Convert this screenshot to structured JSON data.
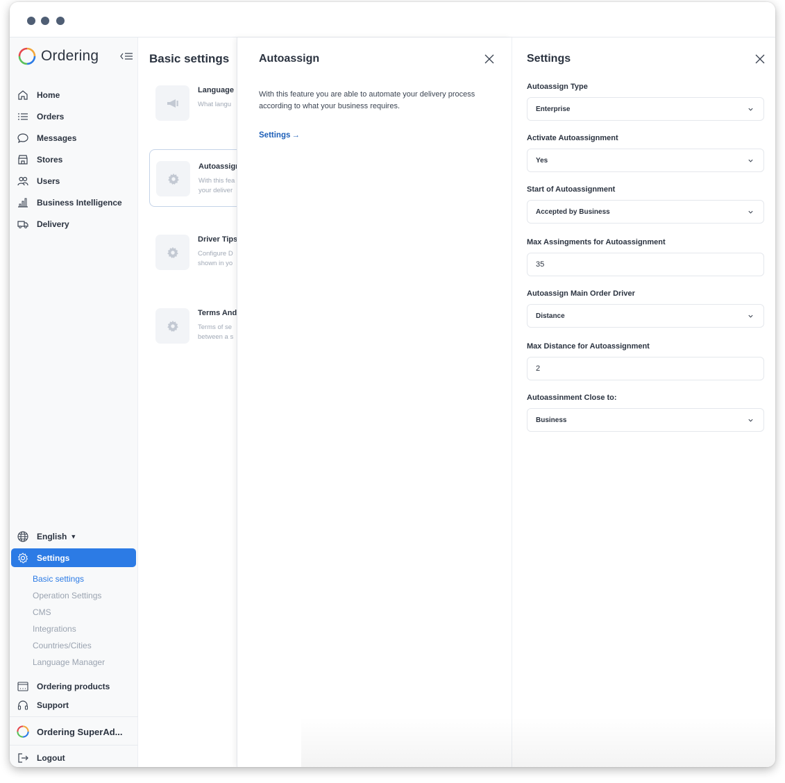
{
  "app": {
    "brand": "Ordering"
  },
  "sidebar": {
    "items": [
      {
        "label": "Home",
        "icon": "home-icon"
      },
      {
        "label": "Orders",
        "icon": "list-icon"
      },
      {
        "label": "Messages",
        "icon": "chat-icon"
      },
      {
        "label": "Stores",
        "icon": "store-icon"
      },
      {
        "label": "Users",
        "icon": "users-icon"
      },
      {
        "label": "Business Intelligence",
        "icon": "bar-chart-icon"
      },
      {
        "label": "Delivery",
        "icon": "truck-icon"
      }
    ],
    "language": "English",
    "settings_label": "Settings",
    "sub_items": [
      "Basic settings",
      "Operation Settings",
      "CMS",
      "Integrations",
      "Countries/Cities",
      "Language Manager"
    ],
    "ordering_products": "Ordering products",
    "support": "Support",
    "account_name": "Ordering SuperAd...",
    "logout": "Logout",
    "accent_color": "#2c7be5"
  },
  "basic_settings": {
    "title": "Basic settings",
    "cards": [
      {
        "title": "Language",
        "desc": "What langu",
        "icon": "megaphone-icon"
      },
      {
        "title": "Autoassign",
        "desc": "With this fea\nyour deliver",
        "icon": "gear-icon"
      },
      {
        "title": "Driver Tips",
        "desc": "Configure D\nshown in yo",
        "icon": "gear-icon"
      },
      {
        "title": "Terms And",
        "desc": "Terms of se\nbetween a s",
        "icon": "gear-icon"
      }
    ]
  },
  "autoassign": {
    "title": "Autoassign",
    "description": "With this feature you are able to automate your delivery process according to what your business requires.",
    "link_label": "Settings"
  },
  "settings_panel": {
    "title": "Settings",
    "fields": [
      {
        "label": "Autoassign Type",
        "value": "Enterprise",
        "kind": "select"
      },
      {
        "label": "Activate Autoassignment",
        "value": "Yes",
        "kind": "select"
      },
      {
        "label": "Start of Autoassignment",
        "value": "Accepted by Business",
        "kind": "select"
      },
      {
        "label": "Max Assingments for Autoassignment",
        "value": "35",
        "kind": "input"
      },
      {
        "label": "Autoassign Main Order Driver",
        "value": "Distance",
        "kind": "select"
      },
      {
        "label": "Max Distance for Autoassignment",
        "value": "2",
        "kind": "input"
      },
      {
        "label": "Autoassinment Close to:",
        "value": "Business",
        "kind": "select"
      }
    ]
  }
}
